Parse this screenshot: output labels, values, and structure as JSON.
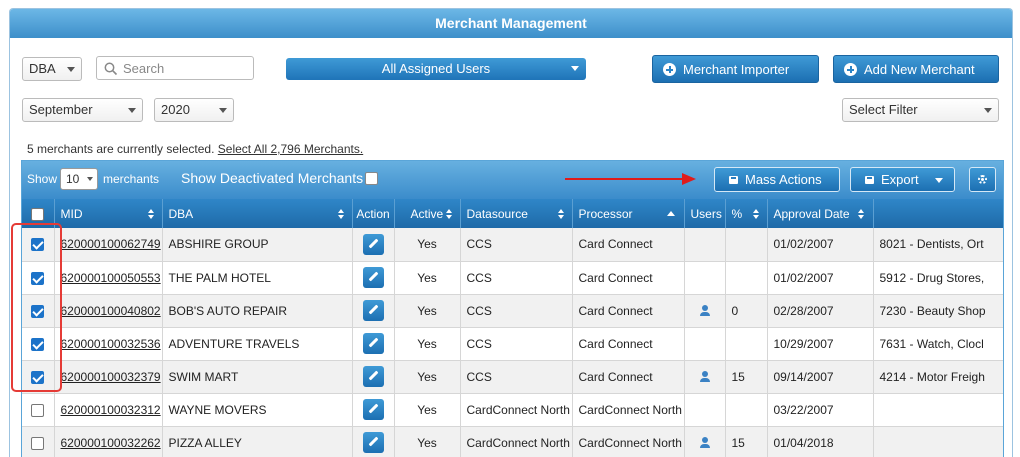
{
  "header": {
    "title": "Merchant Management"
  },
  "filters": {
    "dba_select": "DBA",
    "search_placeholder": "Search",
    "assigned_users": "All Assigned Users",
    "month": "September",
    "year": "2020",
    "select_filter": "Select Filter"
  },
  "actions": {
    "merchant_importer": "Merchant Importer",
    "add_new_merchant": "Add New Merchant"
  },
  "selection": {
    "text": "5 merchants are currently selected.",
    "select_all_link": "Select All 2,796 Merchants."
  },
  "toolbar": {
    "show_label": "Show",
    "page_size": "10",
    "merchants_label": "merchants",
    "show_deactivated": "Show Deactivated Merchants",
    "mass_actions": "Mass Actions",
    "export": "Export"
  },
  "table": {
    "columns": {
      "mid": "MID",
      "dba": "DBA",
      "action": "Action",
      "active": "Active",
      "datasource": "Datasource",
      "processor": "Processor",
      "users": "Users",
      "percent": "%",
      "approval_date": "Approval Date"
    },
    "rows": [
      {
        "checked": true,
        "mid": "620000100062749",
        "dba": "ABSHIRE GROUP",
        "active": "Yes",
        "datasource": "CCS",
        "processor": "Card Connect",
        "has_user": false,
        "percent": "",
        "approval_date": "01/02/2007",
        "mcc": "8021 - Dentists, Ort"
      },
      {
        "checked": true,
        "mid": "620000100050553",
        "dba": "THE PALM HOTEL",
        "active": "Yes",
        "datasource": "CCS",
        "processor": "Card Connect",
        "has_user": false,
        "percent": "",
        "approval_date": "01/02/2007",
        "mcc": "5912 - Drug Stores,"
      },
      {
        "checked": true,
        "mid": "620000100040802",
        "dba": "BOB'S AUTO REPAIR",
        "active": "Yes",
        "datasource": "CCS",
        "processor": "Card Connect",
        "has_user": true,
        "percent": "0",
        "approval_date": "02/28/2007",
        "mcc": "7230 - Beauty Shop"
      },
      {
        "checked": true,
        "mid": "620000100032536",
        "dba": "ADVENTURE TRAVELS",
        "active": "Yes",
        "datasource": "CCS",
        "processor": "Card Connect",
        "has_user": false,
        "percent": "",
        "approval_date": "10/29/2007",
        "mcc": "7631 - Watch, Clocl"
      },
      {
        "checked": true,
        "mid": "620000100032379",
        "dba": "SWIM MART",
        "active": "Yes",
        "datasource": "CCS",
        "processor": "Card Connect",
        "has_user": true,
        "percent": "15",
        "approval_date": "09/14/2007",
        "mcc": "4214 - Motor Freigh"
      },
      {
        "checked": false,
        "mid": "620000100032312",
        "dba": "WAYNE MOVERS",
        "active": "Yes",
        "datasource": "CardConnect North",
        "processor": "CardConnect North",
        "has_user": false,
        "percent": "",
        "approval_date": "03/22/2007",
        "mcc": ""
      },
      {
        "checked": false,
        "mid": "620000100032262",
        "dba": "PIZZA ALLEY",
        "active": "Yes",
        "datasource": "CardConnect North",
        "processor": "CardConnect North",
        "has_user": true,
        "percent": "15",
        "approval_date": "01/04/2018",
        "mcc": ""
      }
    ]
  }
}
